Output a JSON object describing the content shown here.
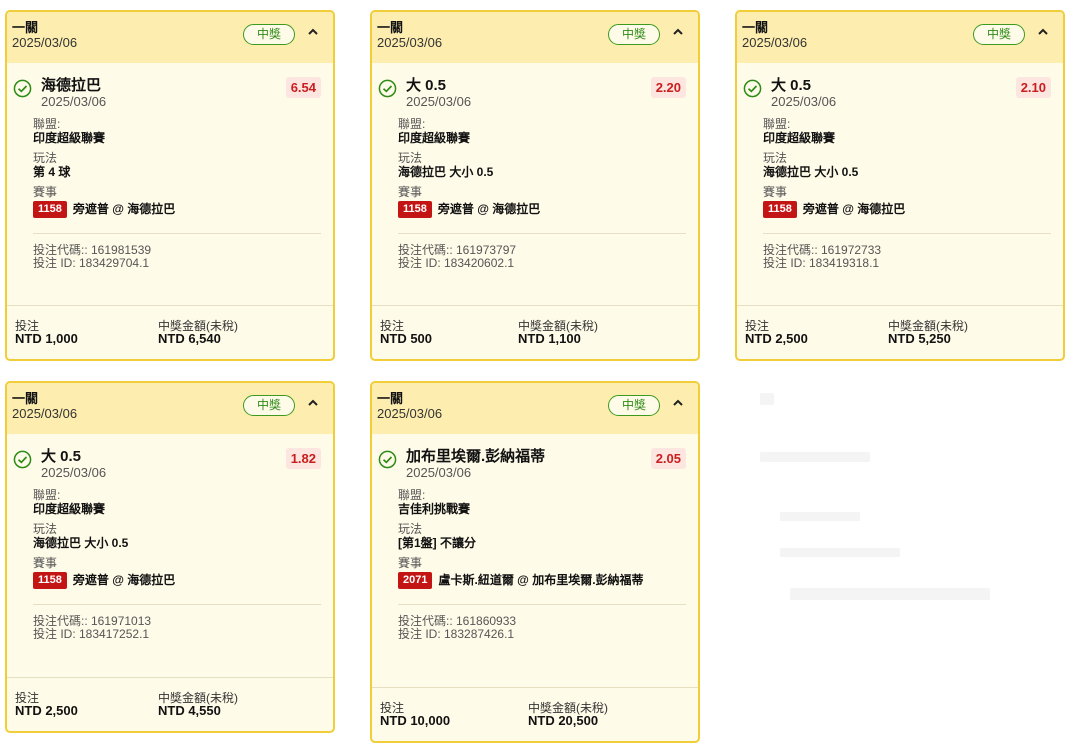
{
  "cards": [
    {
      "header": {
        "type": "一關",
        "date": "2025/03/06",
        "badge": "中獎"
      },
      "selection": {
        "name": "海德拉巴",
        "date": "2025/03/06",
        "odds": "6.54"
      },
      "league_label": "聯盟:",
      "league": "印度超級聯賽",
      "play_label": "玩法",
      "play": "第 4 球",
      "event_label": "賽事",
      "event_id": "1158",
      "event_name": "旁遮普 @ 海德拉巴",
      "bet_code": "投注代碼:: 161981539",
      "bet_id": "投注 ID: 183429704.1",
      "stake_label": "投注",
      "stake": "NTD 1,000",
      "win_label": "中獎金額(未稅)",
      "win": "NTD 6,540"
    },
    {
      "header": {
        "type": "一關",
        "date": "2025/03/06",
        "badge": "中獎"
      },
      "selection": {
        "name": "大 0.5",
        "date": "2025/03/06",
        "odds": "2.20"
      },
      "league_label": "聯盟:",
      "league": "印度超級聯賽",
      "play_label": "玩法",
      "play": "海德拉巴 大小 0.5",
      "event_label": "賽事",
      "event_id": "1158",
      "event_name": "旁遮普 @ 海德拉巴",
      "bet_code": "投注代碼:: 161973797",
      "bet_id": "投注 ID: 183420602.1",
      "stake_label": "投注",
      "stake": "NTD 500",
      "win_label": "中獎金額(未稅)",
      "win": "NTD 1,100"
    },
    {
      "header": {
        "type": "一關",
        "date": "2025/03/06",
        "badge": "中獎"
      },
      "selection": {
        "name": "大 0.5",
        "date": "2025/03/06",
        "odds": "2.10"
      },
      "league_label": "聯盟:",
      "league": "印度超級聯賽",
      "play_label": "玩法",
      "play": "海德拉巴 大小 0.5",
      "event_label": "賽事",
      "event_id": "1158",
      "event_name": "旁遮普 @ 海德拉巴",
      "bet_code": "投注代碼:: 161972733",
      "bet_id": "投注 ID: 183419318.1",
      "stake_label": "投注",
      "stake": "NTD 2,500",
      "win_label": "中獎金額(未稅)",
      "win": "NTD 5,250"
    },
    {
      "header": {
        "type": "一關",
        "date": "2025/03/06",
        "badge": "中獎"
      },
      "selection": {
        "name": "大 0.5",
        "date": "2025/03/06",
        "odds": "1.82"
      },
      "league_label": "聯盟:",
      "league": "印度超級聯賽",
      "play_label": "玩法",
      "play": "海德拉巴 大小 0.5",
      "event_label": "賽事",
      "event_id": "1158",
      "event_name": "旁遮普 @ 海德拉巴",
      "bet_code": "投注代碼:: 161971013",
      "bet_id": "投注 ID: 183417252.1",
      "stake_label": "投注",
      "stake": "NTD 2,500",
      "win_label": "中獎金額(未稅)",
      "win": "NTD 4,550"
    },
    {
      "header": {
        "type": "一關",
        "date": "2025/03/06",
        "badge": "中獎"
      },
      "selection": {
        "name": "加布里埃爾.彭納福蒂",
        "date": "2025/03/06",
        "odds": "2.05"
      },
      "league_label": "聯盟:",
      "league": "吉佳利挑戰賽",
      "play_label": "玩法",
      "play": "[第1盤] 不讓分",
      "event_label": "賽事",
      "event_id": "2071",
      "event_name": "盧卡斯.紐道爾 @ 加布里埃爾.彭納福蒂",
      "bet_code": "投注代碼:: 161860933",
      "bet_id": "投注 ID: 183287426.1",
      "stake_label": "投注",
      "stake": "NTD 10,000",
      "win_label": "中獎金額(未稅)",
      "win": "NTD 20,500"
    }
  ],
  "colors": {
    "card_bg": "#fffbe9",
    "header_bg": "#fdeeb0",
    "border": "#f1cd3a",
    "win_green": "#2e8b16",
    "odds_red": "#c81e1e",
    "event_badge": "#c41515"
  },
  "icons": {
    "status": "check-circle-icon",
    "collapse": "chevron-up-icon"
  }
}
